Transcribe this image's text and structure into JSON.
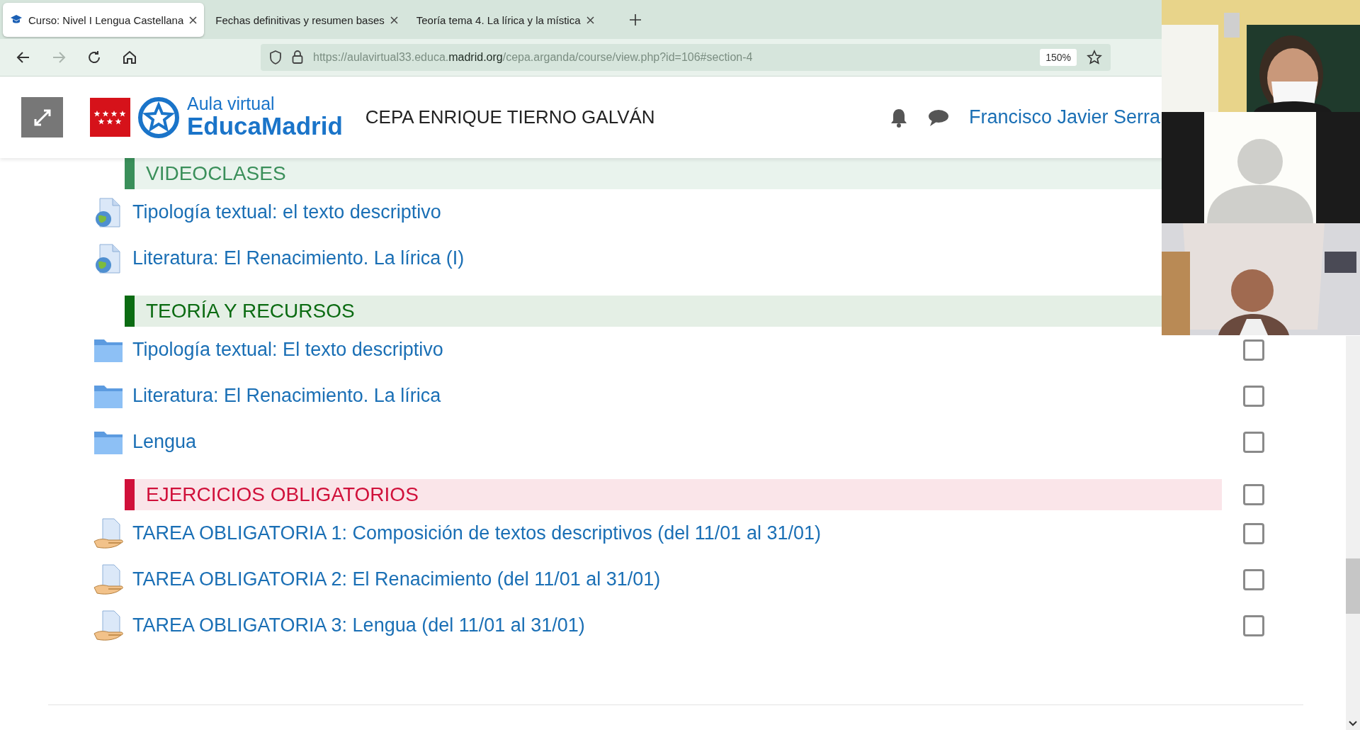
{
  "tabs": [
    {
      "label": "Curso: Nivel I Lengua Castellana",
      "selected": true
    },
    {
      "label": "Fechas definitivas y resumen bases",
      "selected": false
    },
    {
      "label": "Teoría tema 4. La lírica y la mística",
      "selected": false
    }
  ],
  "toolbar": {
    "forward_disabled": true,
    "url": {
      "prefix": "https://aulavirtual33.educa.",
      "domain": "madrid.org",
      "path": "/cepa.arganda/course/view.php?id=106#section-4"
    },
    "zoom": "150%"
  },
  "header": {
    "logo_top": "Aula virtual",
    "logo_bottom": "EducaMadrid",
    "school": "CEPA ENRIQUE TIERNO GALVÁN",
    "user": "Francisco Javier Serra"
  },
  "sections": [
    {
      "title": "VIDEOCLASES",
      "color": "#3a8f5a",
      "items": [
        {
          "kind": "url",
          "label": "Tipología textual: el texto descriptivo"
        },
        {
          "kind": "url",
          "label": "Literatura: El Renacimiento. La lírica (I)"
        }
      ]
    },
    {
      "title": "TEORÍA Y RECURSOS",
      "color": "#0b6b12",
      "items": [
        {
          "kind": "folder",
          "label": "Tipología textual: El texto descriptivo",
          "checked": false
        },
        {
          "kind": "folder",
          "label": "Literatura: El Renacimiento. La lírica",
          "checked": false
        },
        {
          "kind": "folder",
          "label": "Lengua",
          "checked": false
        }
      ]
    },
    {
      "title": "EJERCICIOS OBLIGATORIOS",
      "color": "#d0103a",
      "checkbox": {
        "checked": false
      },
      "items": [
        {
          "kind": "assign",
          "label": "TAREA OBLIGATORIA 1: Composición de textos descriptivos (del 11/01 al 31/01)",
          "checked": false
        },
        {
          "kind": "assign",
          "label": "TAREA OBLIGATORIA 2: El Renacimiento (del 11/01 al 31/01)",
          "checked": false
        },
        {
          "kind": "assign",
          "label": "TAREA OBLIGATORIA 3: Lengua (del 11/01 al 31/01)",
          "checked": false
        }
      ]
    }
  ],
  "video_tiles": [
    {
      "kind": "picture"
    },
    {
      "kind": "avatar"
    },
    {
      "kind": "picture"
    }
  ]
}
